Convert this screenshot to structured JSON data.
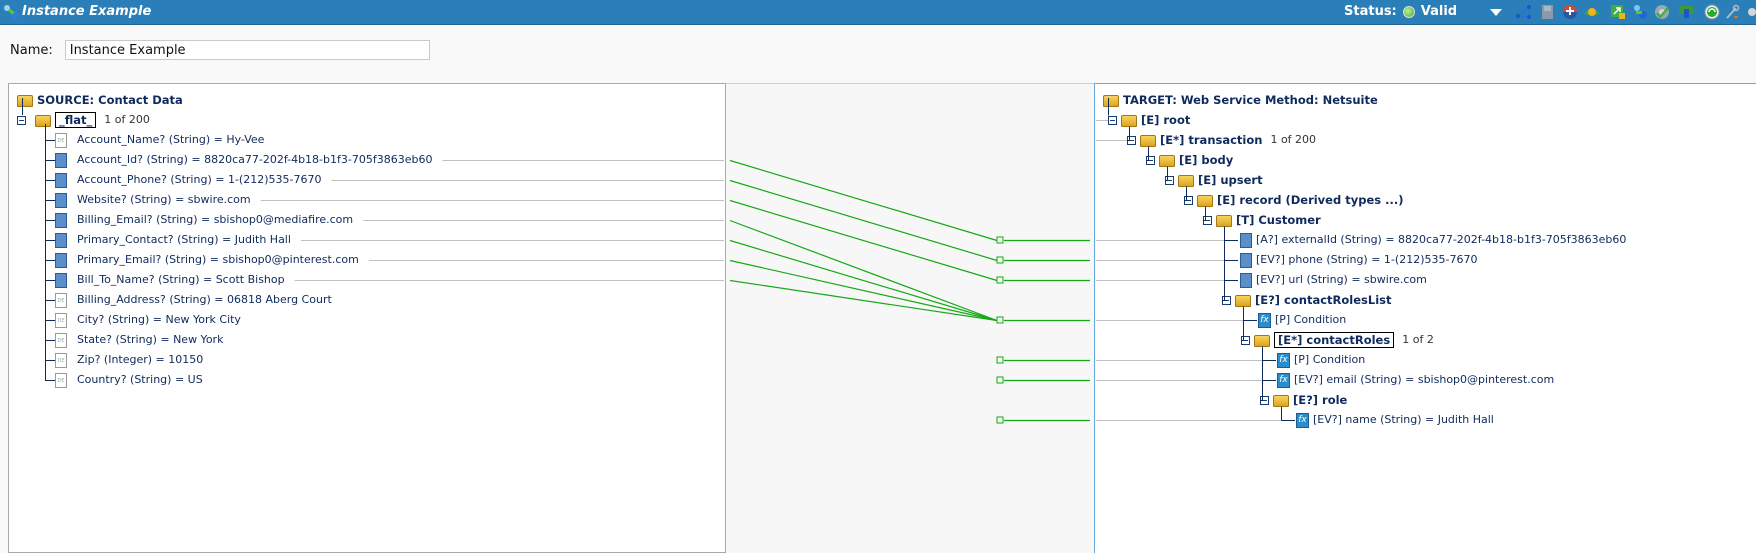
{
  "window": {
    "title": "Instance Example",
    "status_label": "Status:",
    "status_value": "Valid",
    "status_color": "#4aa52a",
    "toolbar_icons": [
      "dropdown-arrow-icon",
      "diagram-icon",
      "save-icon",
      "life-ring-icon",
      "planet-icon",
      "export-icon",
      "user-icon",
      "check-disc-icon",
      "network-icon",
      "refresh-icon",
      "wrench-icon"
    ]
  },
  "name_field": {
    "label": "Name:",
    "value": "Instance Example"
  },
  "source": {
    "title": "SOURCE: Contact Data",
    "group": {
      "label": "_flat_",
      "count": "1 of 200"
    },
    "fields": [
      {
        "label": "Account_Name? (String) = Hy-Vee",
        "mapped": false
      },
      {
        "label": "Account_Id? (String) = 8820ca77-202f-4b18-b1f3-705f3863eb60",
        "mapped": true
      },
      {
        "label": "Account_Phone? (String) = 1-(212)535-7670",
        "mapped": true
      },
      {
        "label": "Website? (String) = sbwire.com",
        "mapped": true
      },
      {
        "label": "Billing_Email? (String) = sbishop0@mediafire.com",
        "mapped": true
      },
      {
        "label": "Primary_Contact? (String) = Judith Hall",
        "mapped": true
      },
      {
        "label": "Primary_Email? (String) = sbishop0@pinterest.com",
        "mapped": true
      },
      {
        "label": "Bill_To_Name? (String) = Scott Bishop",
        "mapped": true
      },
      {
        "label": "Billing_Address? (String) = 06818 Aberg Court",
        "mapped": false
      },
      {
        "label": "City? (String) = New York City",
        "mapped": false
      },
      {
        "label": "State? (String) = New York",
        "mapped": false
      },
      {
        "label": "Zip? (Integer) = 10150",
        "mapped": false
      },
      {
        "label": "Country? (String) = US",
        "mapped": false
      }
    ]
  },
  "target": {
    "title": "TARGET: Web Service Method: Netsuite",
    "nodes": [
      {
        "label": "[E] root",
        "type": "folder",
        "depth": 0
      },
      {
        "label": "[E*] transaction",
        "count": "1 of 200",
        "type": "folder",
        "depth": 1
      },
      {
        "label": "[E] body",
        "type": "folder",
        "depth": 2
      },
      {
        "label": "[E] upsert",
        "type": "folder",
        "depth": 3
      },
      {
        "label": "[E] record (Derived types ...)",
        "type": "folder",
        "depth": 4
      },
      {
        "label": "[T] Customer",
        "type": "folder",
        "depth": 5
      },
      {
        "label": "[A?] externalId (String) = 8820ca77-202f-4b18-b1f3-705f3863eb60",
        "type": "doc",
        "depth": 6
      },
      {
        "label": "[EV?] phone  (String) = 1-(212)535-7670",
        "type": "doc",
        "depth": 6
      },
      {
        "label": "[EV?] url  (String) = sbwire.com",
        "type": "doc",
        "depth": 6
      },
      {
        "label": "[E?] contactRolesList",
        "type": "folder",
        "depth": 6
      },
      {
        "label": "[P] Condition",
        "type": "fx",
        "depth": 7
      },
      {
        "label": "[E*] contactRoles",
        "count": "1 of 2",
        "type": "folder",
        "depth": 7,
        "selected": true
      },
      {
        "label": "[P] Condition",
        "type": "fx",
        "depth": 8
      },
      {
        "label": "[EV?] email  (String) = sbishop0@pinterest.com",
        "type": "fx",
        "depth": 8
      },
      {
        "label": "[E?] role",
        "type": "folder",
        "depth": 8
      },
      {
        "label": "[EV?] name  (String) = Judith Hall",
        "type": "fx",
        "depth": 9
      }
    ]
  },
  "mappings": [
    {
      "from": 1,
      "to": 6
    },
    {
      "from": 2,
      "to": 7
    },
    {
      "from": 3,
      "to": 8
    },
    {
      "from": 4,
      "to": 10
    },
    {
      "from": 5,
      "to": 10
    },
    {
      "from": 6,
      "to": 10
    },
    {
      "from": 7,
      "to": 10
    }
  ],
  "unlinked_target_markers": [
    12,
    13,
    15
  ],
  "colors": {
    "mapping_line": "#16a816",
    "titlebar": "#2b7fb8"
  }
}
